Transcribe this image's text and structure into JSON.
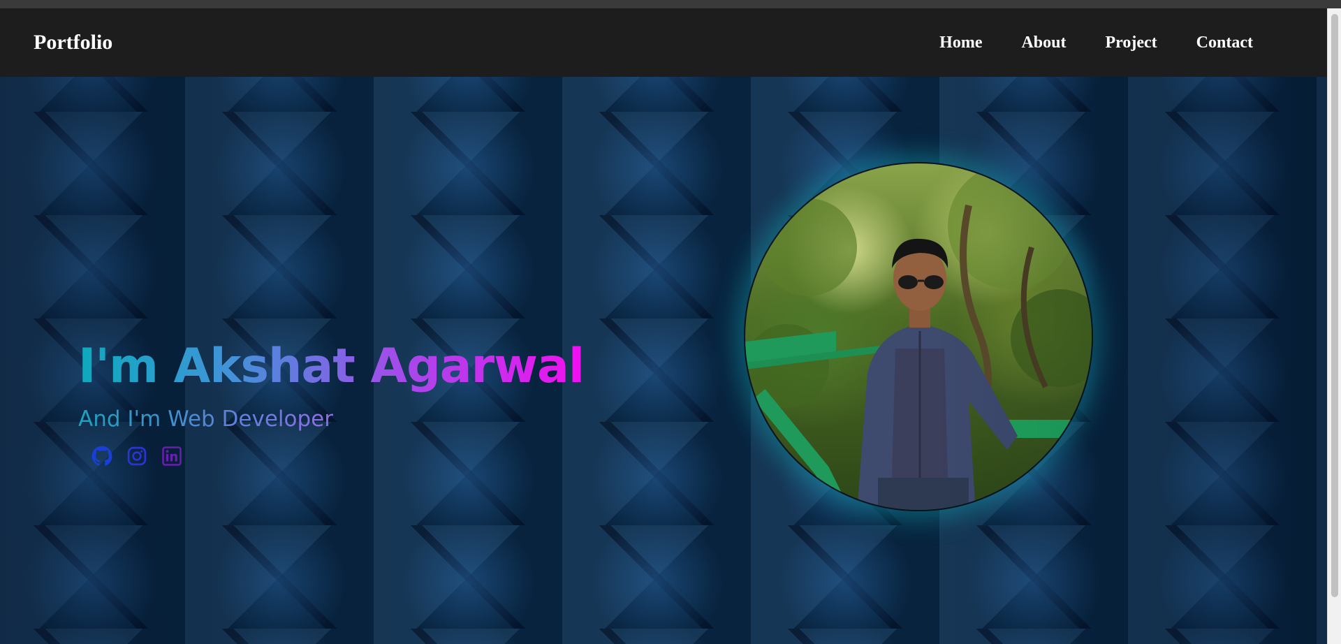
{
  "nav": {
    "brand": "Portfolio",
    "links": [
      "Home",
      "About",
      "Project",
      "Contact"
    ]
  },
  "hero": {
    "title": "I'm Akshat Agarwal",
    "subtitle": "And I'm Web Developer",
    "socials": [
      {
        "icon": "github-icon",
        "color": "#1a3fd6"
      },
      {
        "icon": "instagram-icon",
        "color": "#2b34cf"
      },
      {
        "icon": "linkedin-icon",
        "color": "#6a1fb0"
      }
    ]
  },
  "colors": {
    "navbar": "#1d1d1d",
    "title_gradient_start": "#12d2e6",
    "title_gradient_end": "#f010f0",
    "photo_glow": "#14c8d2"
  }
}
